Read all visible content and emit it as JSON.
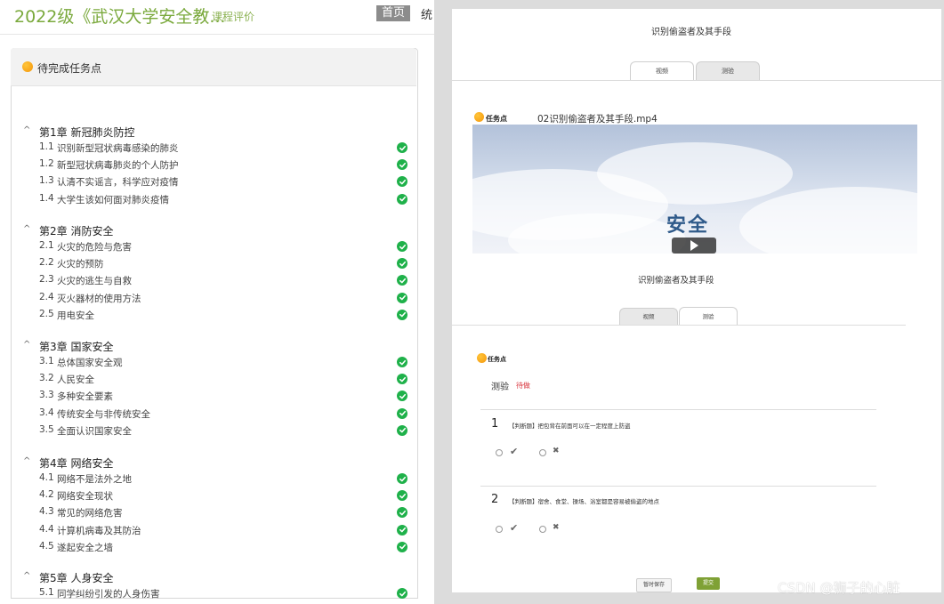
{
  "left": {
    "course_title": "2022级《武汉大学安全教...",
    "eval_link": "课程评价",
    "home_button": "首页",
    "stat_link": "统",
    "pending_label": "待完成任务点",
    "chapters": [
      {
        "caret": "^",
        "title": "第1章 新冠肺炎防控",
        "lessons": [
          {
            "num": "1.1",
            "title": "识别新型冠状病毒感染的肺炎"
          },
          {
            "num": "1.2",
            "title": "新型冠状病毒肺炎的个人防护"
          },
          {
            "num": "1.3",
            "title": "认清不实谣言，科学应对疫情"
          },
          {
            "num": "1.4",
            "title": "大学生该如何面对肺炎疫情"
          }
        ]
      },
      {
        "caret": "^",
        "title": "第2章 消防安全",
        "lessons": [
          {
            "num": "2.1",
            "title": "火灾的危险与危害"
          },
          {
            "num": "2.2",
            "title": "火灾的预防"
          },
          {
            "num": "2.3",
            "title": "火灾的逃生与自救"
          },
          {
            "num": "2.4",
            "title": "灭火器材的使用方法"
          },
          {
            "num": "2.5",
            "title": "用电安全"
          }
        ]
      },
      {
        "caret": "^",
        "title": "第3章 国家安全",
        "lessons": [
          {
            "num": "3.1",
            "title": "总体国家安全观"
          },
          {
            "num": "3.2",
            "title": "人民安全"
          },
          {
            "num": "3.3",
            "title": "多种安全要素"
          },
          {
            "num": "3.4",
            "title": "传统安全与非传统安全"
          },
          {
            "num": "3.5",
            "title": "全面认识国家安全"
          }
        ]
      },
      {
        "caret": "^",
        "title": "第4章 网络安全",
        "lessons": [
          {
            "num": "4.1",
            "title": "网络不是法外之地"
          },
          {
            "num": "4.2",
            "title": "网络安全现状"
          },
          {
            "num": "4.3",
            "title": "常见的网络危害"
          },
          {
            "num": "4.4",
            "title": "计算机病毒及其防治"
          },
          {
            "num": "4.5",
            "title": "遂起安全之墙"
          }
        ]
      },
      {
        "caret": "^",
        "title": "第5章 人身安全",
        "lessons": [
          {
            "num": "5.1",
            "title": "同学纠纷引发的人身伤害"
          }
        ]
      }
    ]
  },
  "right": {
    "top_title": "识别偷盗者及其手段",
    "top_tabs": [
      {
        "label": "视频",
        "active": true
      },
      {
        "label": "测验",
        "active": false
      }
    ],
    "task_point_label": "任务点",
    "video_filename": "02识别偷盗者及其手段.mp4",
    "video_logo_text": "安全",
    "quiz_title": "识别偷盗者及其手段",
    "quiz_tabs": [
      {
        "label": "视频",
        "active": false
      },
      {
        "label": "测验",
        "active": true
      }
    ],
    "quiz_label": "测验",
    "quiz_status": "待做",
    "questions": [
      {
        "num": "1",
        "text": "【判断题】把包背在前面可以在一定程度上防盗"
      },
      {
        "num": "2",
        "text": "【判断题】宿舍、食堂、操场、浴室都是容易被偷盗的地点"
      }
    ],
    "option_true_icon": "✔",
    "option_false_icon": "✖",
    "save_button": "暂时保存",
    "submit_button": "提交"
  },
  "watermark": "CSDN @狮子的心脏",
  "colors": {
    "accent_green": "#7aa93c",
    "check_green": "#1fb14a",
    "orange": "#f5960a",
    "pending_red": "#d9363e",
    "submit_green": "#7fa135"
  },
  "icons": {
    "pending": "orange-dot-icon",
    "done": "check-circle-icon",
    "collapse": "caret-up-icon"
  }
}
